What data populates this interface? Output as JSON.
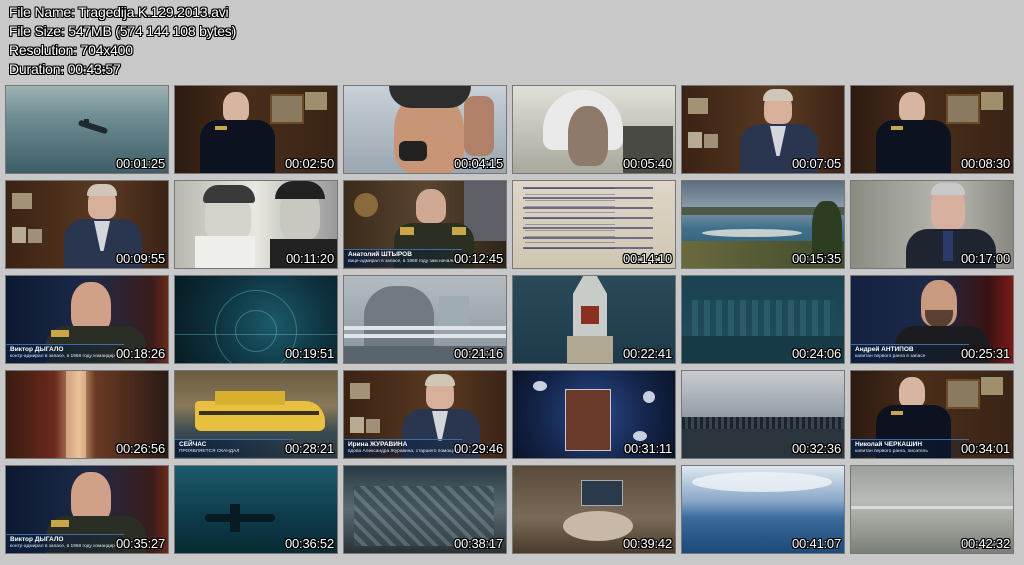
{
  "header": {
    "file_name": "File Name: Tragedija.K.129.2013.avi",
    "file_size": "File Size: 547MB (574 144 108 bytes)",
    "resolution": "Resolution: 704x400",
    "duration": "Duration: 00:43:57"
  },
  "thumbnails": [
    {
      "time": "00:01:25",
      "scene": "sea-submarine",
      "caption_name": "",
      "caption_desc": ""
    },
    {
      "time": "00:02:50",
      "scene": "admiral-office",
      "caption_name": "",
      "caption_desc": ""
    },
    {
      "time": "00:04:15",
      "scene": "radio-man",
      "caption_name": "",
      "caption_desc": ""
    },
    {
      "time": "00:05:40",
      "scene": "pilot-helmet",
      "caption_name": "",
      "caption_desc": ""
    },
    {
      "time": "00:07:05",
      "scene": "woman-office",
      "caption_name": "",
      "caption_desc": ""
    },
    {
      "time": "00:08:30",
      "scene": "admiral-office",
      "caption_name": "",
      "caption_desc": ""
    },
    {
      "time": "00:09:55",
      "scene": "woman-office",
      "caption_name": "",
      "caption_desc": ""
    },
    {
      "time": "00:11:20",
      "scene": "bw-photo",
      "caption_name": "",
      "caption_desc": ""
    },
    {
      "time": "00:12:45",
      "scene": "general-interview",
      "caption_name": "Анатолий ШТЫРОВ",
      "caption_desc": "вице-адмирал в запасе, в 1968 году зам.начальника разведки ТОФ"
    },
    {
      "time": "00:14:10",
      "scene": "document",
      "caption_name": "",
      "caption_desc": ""
    },
    {
      "time": "00:15:35",
      "scene": "coast",
      "caption_name": "",
      "caption_desc": ""
    },
    {
      "time": "00:17:00",
      "scene": "man-suit",
      "caption_name": "",
      "caption_desc": ""
    },
    {
      "time": "00:18:26",
      "scene": "old-admiral",
      "caption_name": "Виктор ДЫГАЛО",
      "caption_desc": "контр-адмирал в запасе, в 1968 году командир подводных лодок Тихоокеанского флота"
    },
    {
      "time": "00:19:51",
      "scene": "sonar",
      "caption_name": "",
      "caption_desc": ""
    },
    {
      "time": "00:21:16",
      "scene": "ship-deck",
      "caption_name": "",
      "caption_desc": ""
    },
    {
      "time": "00:22:41",
      "scene": "ship-aerial",
      "caption_name": "",
      "caption_desc": ""
    },
    {
      "time": "00:24:06",
      "scene": "ship-dark",
      "caption_name": "",
      "caption_desc": ""
    },
    {
      "time": "00:25:31",
      "scene": "bearded-man",
      "caption_name": "Андрей АНТИПОВ",
      "caption_desc": "капитан первого ранга в запасе"
    },
    {
      "time": "00:26:56",
      "scene": "blur-red",
      "caption_name": "",
      "caption_desc": ""
    },
    {
      "time": "00:28:21",
      "scene": "yellow-boat",
      "caption_name": "СЕЙЧАС",
      "caption_desc": "ПРОЯВЛЯЕТСЯ СКАНДАЛ"
    },
    {
      "time": "00:29:46",
      "scene": "woman-office",
      "caption_name": "Ирина ЖУРАВИНА",
      "caption_desc": "вдова Александра Журавина, старшего помощника"
    },
    {
      "time": "00:31:11",
      "scene": "underwater-doc",
      "caption_name": "",
      "caption_desc": ""
    },
    {
      "time": "00:32:36",
      "scene": "crew-line",
      "caption_name": "",
      "caption_desc": ""
    },
    {
      "time": "00:34:01",
      "scene": "admiral-office",
      "caption_name": "Николай ЧЕРКАШИН",
      "caption_desc": "капитан первого ранга, писатель"
    },
    {
      "time": "00:35:27",
      "scene": "old-admiral",
      "caption_name": "Виктор ДЫГАЛО",
      "caption_desc": "контр-адмирал в запасе, в 1968 году командир подводных лодок Тихоокеанского флота"
    },
    {
      "time": "00:36:52",
      "scene": "plane-underwater",
      "caption_name": "",
      "caption_desc": ""
    },
    {
      "time": "00:38:17",
      "scene": "wreck",
      "caption_name": "",
      "caption_desc": ""
    },
    {
      "time": "00:39:42",
      "scene": "memorial",
      "caption_name": "",
      "caption_desc": ""
    },
    {
      "time": "00:41:07",
      "scene": "sky-sea",
      "caption_name": "",
      "caption_desc": ""
    },
    {
      "time": "00:42:32",
      "scene": "grey-sea",
      "caption_name": "",
      "caption_desc": ""
    }
  ],
  "colors": {
    "background": "#c8c8c8",
    "timestamp_text": "#ffffff",
    "caption_bar": "#0a1e3c"
  }
}
